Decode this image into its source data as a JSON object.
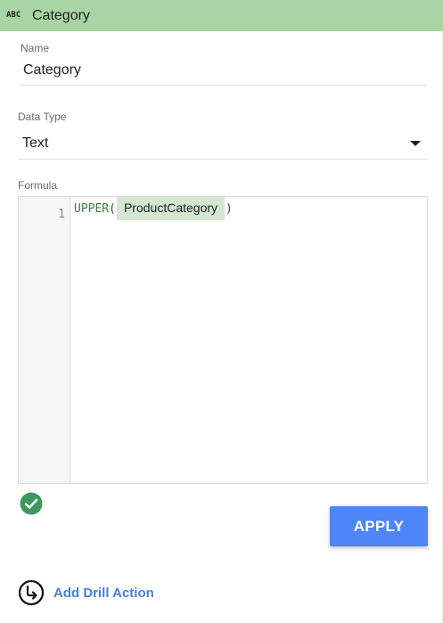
{
  "header": {
    "type_icon": "ABC",
    "title": "Category",
    "background": "#a8d5a3"
  },
  "name_field": {
    "label": "Name",
    "value": "Category"
  },
  "data_type_field": {
    "label": "Data Type",
    "selected": "Text"
  },
  "formula_field": {
    "label": "Formula",
    "line_number": "1",
    "function": "UPPER",
    "open_paren": "(",
    "field_chip": "ProductCategory",
    "close_paren": ")",
    "valid_icon": "check-circle-icon",
    "valid_color": "#3a9a5b"
  },
  "actions": {
    "apply_label": "APPLY",
    "apply_color": "#4f86f7",
    "drill_label": "Add Drill Action",
    "drill_icon": "drill-arrow-icon"
  }
}
